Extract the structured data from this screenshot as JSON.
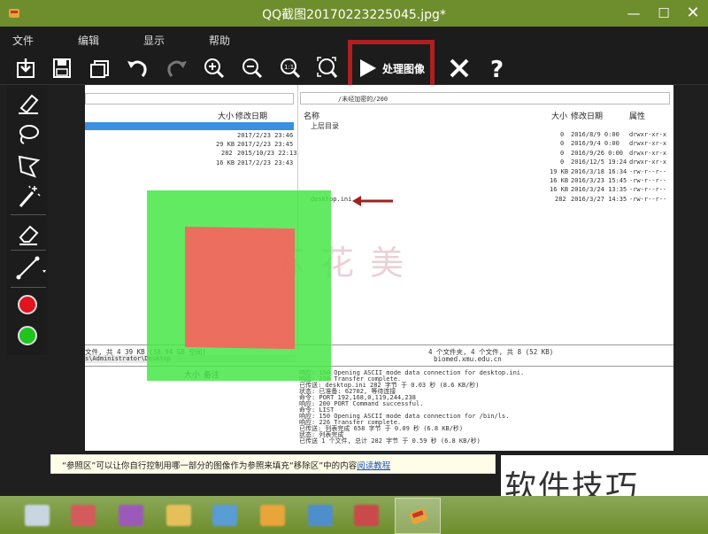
{
  "window": {
    "title": "QQ截图20170223225045.jpg*",
    "min": "—",
    "max": "☐",
    "close": "✕"
  },
  "menu": [
    "文件",
    "编辑",
    "显示",
    "帮助"
  ],
  "toolbar": {
    "icons": [
      "import-icon",
      "save-icon",
      "copy-icon",
      "undo-icon",
      "redo-icon",
      "zoom-in-icon",
      "zoom-out-icon",
      "actual-size-icon",
      "fit-icon"
    ],
    "process_label": "处理图像",
    "cancel_icon": "close-x-icon",
    "help_label": "?"
  },
  "tools": [
    "marker-icon",
    "lasso-icon",
    "polygon-lasso-icon",
    "magic-wand-icon",
    "eraser-icon",
    "line-icon"
  ],
  "colors": {
    "red_swatch": "#e0141e",
    "green_swatch": "#1fc41f",
    "accent": "#b01f1f"
  },
  "screenshot": {
    "left_headers": {
      "size": "大小",
      "modified": "修改日期"
    },
    "left_rows": [
      {
        "size": "",
        "date": "2017/2/23 23:46"
      },
      {
        "size": "29 KB",
        "date": "2017/2/23 23:45"
      },
      {
        "size": "282",
        "date": "2015/10/23 22:13"
      },
      {
        "size": "16 KB",
        "date": "2017/2/23 23:43"
      }
    ],
    "right_path": "/未经加密的/200",
    "right_headers": {
      "name": "名称",
      "size": "大小",
      "modified": "修改日期",
      "attr": "属性"
    },
    "right_rows": [
      {
        "name": "上层目录",
        "size": "",
        "date": "",
        "attr": ""
      },
      {
        "name": "",
        "size": "0",
        "date": "2016/8/9 0:00",
        "attr": "drwxr-xr-x"
      },
      {
        "name": "",
        "size": "0",
        "date": "2016/9/4 0:00",
        "attr": "drwxr-xr-x"
      },
      {
        "name": "",
        "size": "0",
        "date": "2016/9/26 0:00",
        "attr": "drwxr-xr-x"
      },
      {
        "name": "",
        "size": "0",
        "date": "2016/12/5 19:24",
        "attr": "drwxr-xr-x"
      },
      {
        "name": "",
        "size": "19 KB",
        "date": "2016/3/18 16:34",
        "attr": "-rw-r--r--"
      },
      {
        "name": "",
        "size": "16 KB",
        "date": "2016/3/23 15:45",
        "attr": "-rw-r--r--"
      },
      {
        "name": "",
        "size": "16 KB",
        "date": "2016/3/24 13:35",
        "attr": "-rw-r--r--"
      },
      {
        "name": "desktop.ini",
        "size": "282",
        "date": "2016/3/27 14:35",
        "attr": "-rw-r--r--"
      }
    ],
    "left_status": "文件, 共 4 39 KB (38.94 GB 空间)",
    "left_path": "s\\Administrator\\Desktop",
    "queue_headers": {
      "size": "大小",
      "note": "备注"
    },
    "right_status": "4 个文件夹, 4 个文件, 共 8 (52 KB)",
    "right_host": "biomed.xmu.edu.cn",
    "log_lines": [
      "响应: 150 Opening ASCII mode data connection for desktop.ini.",
      "响应: 226 Transfer complete.",
      "已传送: desktop.ini 282 字节 于 0.03 秒 (8.6 KB/秒)",
      "状态: 已准备: 62702, 等待连接",
      "命令: PORT 192,168,0,119,244,238",
      "响应: 200 PORT Command successful.",
      "命令: LIST",
      "响应: 150 Opening ASCII mode data connection for /bin/ls.",
      "响应: 226 Transfer complete.",
      "已传送: 列表完成 658 字节 于 0.09 秒 (6.8 KB/秒)",
      "状态: 列表完成",
      "已传送 1 个文件, 总计 282 字节 于 0.59 秒 (6.8 KB/秒)"
    ],
    "watermark": "苏花美"
  },
  "info": {
    "text": "“参照区”可以让你自行控制用哪一部分的图像作为参照来填充“移除区”中的内容",
    "link": "阅读教程"
  },
  "overlay_caption": "软件技巧"
}
